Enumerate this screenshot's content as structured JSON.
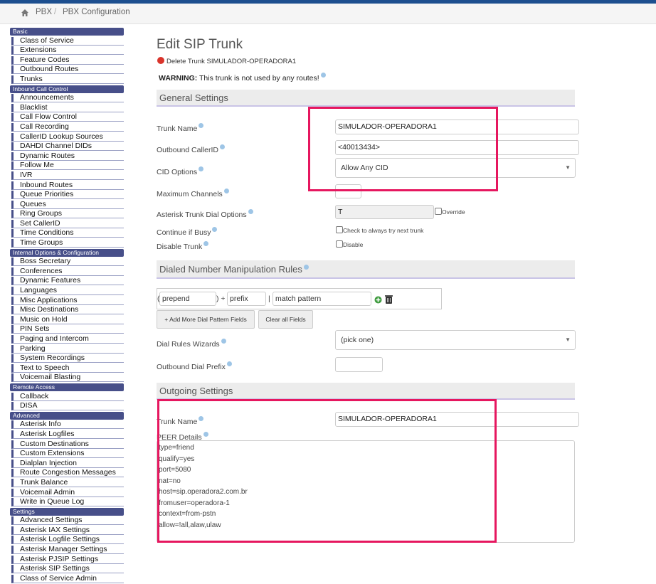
{
  "breadcrumb": {
    "items": [
      "PBX",
      "PBX Configuration"
    ],
    "separator": "/"
  },
  "sidebar": {
    "sections": [
      {
        "title": "Basic",
        "items": [
          "Class of Service",
          "Extensions",
          "Feature Codes",
          "Outbound Routes",
          "Trunks"
        ]
      },
      {
        "title": "Inbound Call Control",
        "items": [
          "Announcements",
          "Blacklist",
          "Call Flow Control",
          "Call Recording",
          "CallerID Lookup Sources",
          "DAHDI Channel DIDs",
          "Dynamic Routes",
          "Follow Me",
          "IVR",
          "Inbound Routes",
          "Queue Priorities",
          "Queues",
          "Ring Groups",
          "Set CallerID",
          "Time Conditions",
          "Time Groups"
        ]
      },
      {
        "title": "Internal Options & Configuration",
        "items": [
          "Boss Secretary",
          "Conferences",
          "Dynamic Features",
          "Languages",
          "Misc Applications",
          "Misc Destinations",
          "Music on Hold",
          "PIN Sets",
          "Paging and Intercom",
          "Parking",
          "System Recordings",
          "Text to Speech",
          "Voicemail Blasting"
        ]
      },
      {
        "title": "Remote Access",
        "items": [
          "Callback",
          "DISA"
        ]
      },
      {
        "title": "Advanced",
        "items": [
          "Asterisk Info",
          "Asterisk Logfiles",
          "Custom Destinations",
          "Custom Extensions",
          "Dialplan Injection",
          "Route Congestion Messages",
          "Trunk Balance",
          "Voicemail Admin",
          "Write in Queue Log"
        ]
      },
      {
        "title": "Settings",
        "items": [
          "Advanced Settings",
          "Asterisk IAX Settings",
          "Asterisk Logfile Settings",
          "Asterisk Manager Settings",
          "Asterisk PJSIP Settings",
          "Asterisk SIP Settings",
          "Class of Service Admin"
        ]
      }
    ]
  },
  "main": {
    "title": "Edit SIP Trunk",
    "delete_link": "Delete Trunk SIMULADOR-OPERADORA1",
    "warning_label": "WARNING:",
    "warning_text": "This trunk is not used by any routes!",
    "general": {
      "heading": "General Settings",
      "trunk_name_label": "Trunk Name",
      "trunk_name_value": "SIMULADOR-OPERADORA1",
      "outbound_callerid_label": "Outbound CallerID",
      "outbound_callerid_value": "<40013434>",
      "cid_options_label": "CID Options",
      "cid_options_value": "Allow Any CID",
      "max_channels_label": "Maximum Channels",
      "max_channels_value": "",
      "dial_options_label": "Asterisk Trunk Dial Options",
      "dial_options_value": "T",
      "override_label": "Override",
      "continue_busy_label": "Continue if Busy",
      "continue_busy_check": "Check to always try next trunk",
      "disable_label": "Disable Trunk",
      "disable_check": "Disable"
    },
    "dialed": {
      "heading": "Dialed Number Manipulation Rules",
      "open_paren": "(",
      "prepend_placeholder": "prepend",
      "close_paren_plus": ") +",
      "prefix_placeholder": "prefix",
      "pipe": "|",
      "match_placeholder": "match pattern",
      "add_more_btn": "+ Add More Dial Pattern Fields",
      "clear_btn": "Clear all Fields",
      "wizards_label": "Dial Rules Wizards",
      "wizards_value": "(pick one)",
      "prefix_label": "Outbound Dial Prefix",
      "prefix_value": ""
    },
    "outgoing": {
      "heading": "Outgoing Settings",
      "trunk_name_label": "Trunk Name",
      "trunk_name_value": "SIMULADOR-OPERADORA1",
      "peer_label": "PEER Details",
      "peer_lines": [
        "type=friend",
        "qualify=yes",
        "port=5080",
        "nat=no",
        "host=sip.operadora2.com.br",
        "fromuser=operadora-1",
        "context=from-pstn",
        "allow=!all,alaw,ulaw"
      ]
    }
  },
  "colors": {
    "accent": "#474f89",
    "highlight": "#e6175f",
    "topbar": "#1d4f8f"
  }
}
